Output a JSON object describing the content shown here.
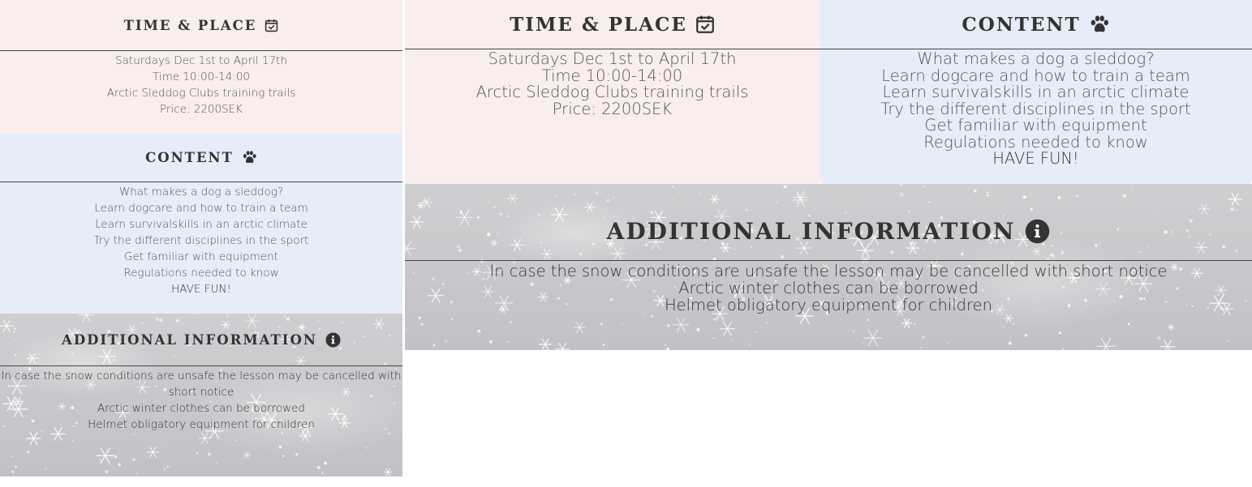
{
  "time_place": {
    "title": "TIME & PLACE",
    "icon": "calendar-check-icon",
    "lines": [
      "Saturdays Dec 1st to April 17th",
      "Time 10:00-14:00",
      "Arctic Sleddog Clubs training trails",
      "Price: 2200SEK"
    ]
  },
  "content": {
    "title": "CONTENT",
    "icon": "paw-icon",
    "lines": [
      "What makes a dog a sleddog?",
      "Learn dogcare and how to train a team",
      "Learn survivalskills in an arctic climate",
      "Try the different disciplines in the sport",
      "Get familiar with equipment",
      "Regulations needed to know",
      "HAVE FUN!"
    ]
  },
  "additional": {
    "title": "ADDITIONAL INFORMATION",
    "icon": "info-circle-icon",
    "lines": [
      "In case the snow conditions are unsafe the lesson may be cancelled with short notice",
      "Arctic winter clothes can be borrowed",
      "Helmet obligatory equipment for children"
    ]
  },
  "colors": {
    "time_place_bg": "#f9eded",
    "content_bg": "#e5edf8",
    "additional_bg": "#c9c9cc",
    "text": "#333333"
  }
}
